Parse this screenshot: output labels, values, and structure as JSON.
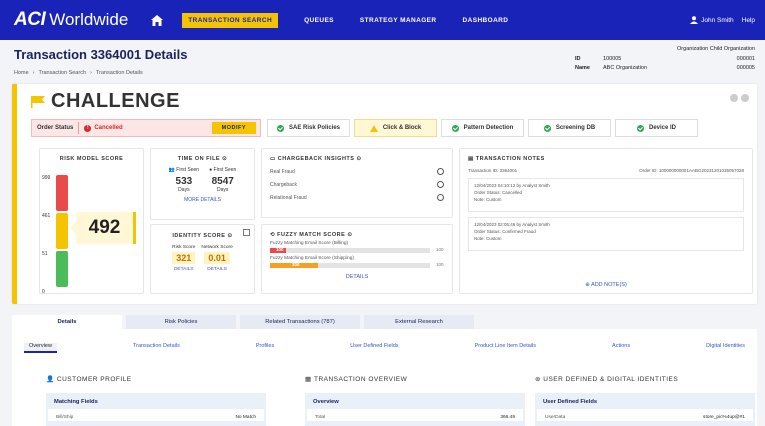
{
  "nav": {
    "logo_aci": "ACI",
    "logo_ww": "Worldwide",
    "items": [
      "TRANSACTION SEARCH",
      "QUEUES",
      "STRATEGY MANAGER",
      "DASHBOARD"
    ],
    "user": "John Smith",
    "help": "Help"
  },
  "header": {
    "title": "Transaction 3364001 Details",
    "breadcrumb": [
      "Home",
      "Transaction Search",
      "Transaction Details"
    ],
    "org_head": "Organization Child Organization",
    "id_label": "ID",
    "id_v1": "100005",
    "id_v2": "000001",
    "name_label": "Name",
    "name_v1": "ABC Organization",
    "name_v2": "000005"
  },
  "challenge": {
    "label": "CHALLENGE",
    "order_status_label": "Order Status",
    "order_status_value": "Cancelled",
    "modify": "MODIFY",
    "checks": [
      "SAE Risk Policies",
      "Click & Block",
      "Pattern Detection",
      "Screening DB",
      "Device ID"
    ]
  },
  "risk": {
    "title": "RISK MODEL SCORE",
    "ticks": [
      "999",
      "461",
      "51",
      "0"
    ],
    "score": "492"
  },
  "tof": {
    "title": "TIME ON FILE",
    "first_seen_a": "First Seen",
    "first_seen_b": "First Seen",
    "val_a": "533",
    "val_b": "8547",
    "unit_a": "Days",
    "unit_b": "Days",
    "more": "MORE DETAILS"
  },
  "identity": {
    "title": "IDENTITY SCORE",
    "risk_label": "Risk Score",
    "net_label": "Network Score",
    "risk_val": "321",
    "net_val": "0.01",
    "details_a": "DETAILS",
    "details_b": "DETAILS"
  },
  "chargeback": {
    "title": "CHARGEBACK INSIGHTS",
    "rows": [
      "Real Fraud",
      "Chargeback",
      "Relational Fraud"
    ]
  },
  "fuzzy": {
    "title": "FUZZY MATCH SCORE",
    "rows": [
      {
        "label": "Fuzzy Matching Email Score (Billing)",
        "value": "100",
        "max": "100",
        "fraction": 0.1,
        "color": "#e94a4a"
      },
      {
        "label": "Fuzzy Matching Email Score (Shipping)",
        "value": "300",
        "max": "100",
        "fraction": 0.3,
        "color": "#f5a020"
      }
    ],
    "details": "DETAILS"
  },
  "notes": {
    "title": "TRANSACTION NOTES",
    "txn_id": "Transaction ID: 3364001",
    "order_id": "Order ID: 100000000001AABG20231201035057028",
    "entries": [
      {
        "line1": "12/04/2023 04:10:12 by Analyst Smith",
        "line2": "Order Status: Cancelled",
        "line3": "Note: Custom"
      },
      {
        "line1": "12/04/2023 02:05:46 by Analyst Smith",
        "line2": "Order Status: Confirmed Fraud",
        "line3": "Note: Custom"
      }
    ],
    "add": "ADD NOTE(S)"
  },
  "bottom_tabs": [
    "Details",
    "Risk Policies",
    "Related Transactions (787)",
    "External Research"
  ],
  "subtabs": [
    "Overview",
    "Transaction Details",
    "Profiles",
    "User Defined Fields",
    "Product Line Item Details",
    "Actions",
    "Digital Identities"
  ],
  "sections": {
    "customer": {
      "title": "CUSTOMER PROFILE",
      "head": "Matching Fields",
      "row_label": "Bill/Ship",
      "row_val": "No Match"
    },
    "overview": {
      "title": "TRANSACTION OVERVIEW",
      "head": "Overview",
      "row_label": "Total",
      "row_val": "366.49"
    },
    "udf": {
      "title": "USER DEFINED & DIGITAL IDENTITIES",
      "head": "User Defined Fields",
      "row_label": "UserData",
      "row_val": "store_pic%4up@#1"
    }
  }
}
